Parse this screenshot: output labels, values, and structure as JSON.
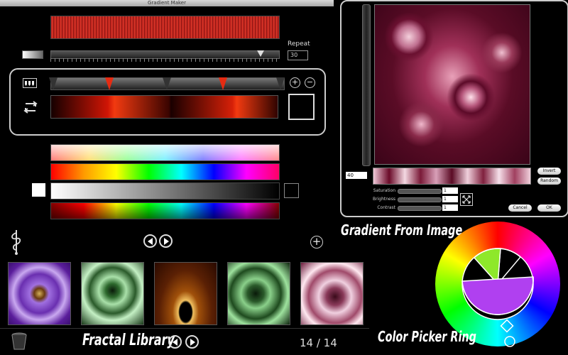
{
  "window": {
    "title": "Gradient Maker"
  },
  "editor": {
    "repeat_label": "Repeat",
    "repeat_value": "30",
    "slider_level": 0.93,
    "add_stop_symbol": "+",
    "remove_stop_symbol": "−",
    "main_gradient_colors": [
      "#150000",
      "#d01505",
      "#f23a10",
      "#3a0400",
      "#d52008",
      "#f23a10"
    ]
  },
  "presets": {
    "rows": 4,
    "white_swatch": "#ffffff",
    "black_swatch": "#000000"
  },
  "library": {
    "title": "Fractal Library",
    "page_counter": "14 / 14",
    "add_symbol": "+",
    "thumbnails": [
      {
        "name": "purple-mandala"
      },
      {
        "name": "green-fern"
      },
      {
        "name": "golden-lightning"
      },
      {
        "name": "green-spiral"
      },
      {
        "name": "pink-spiral"
      }
    ]
  },
  "image_panel": {
    "title": "Gradient From Image",
    "sample_size": "40",
    "invert_label": "Invert",
    "random_label": "Random",
    "saturation_label": "Saturation",
    "saturation_value": "1",
    "brightness_label": "Brightness",
    "brightness_value": "1",
    "contrast_label": "Contrast",
    "contrast_value": "1",
    "cancel_label": "Cancel",
    "ok_label": "OK"
  },
  "color_ring": {
    "title": "Color Picker Ring",
    "segment_colors": [
      "#ff0000",
      "#ffff00",
      "#00ff00",
      "#00ffff",
      "#0000ff",
      "#ff00ff"
    ],
    "inner_colors": {
      "top": "#000000",
      "green_wedge": "#88e830",
      "bottom": "#b040f0"
    }
  }
}
